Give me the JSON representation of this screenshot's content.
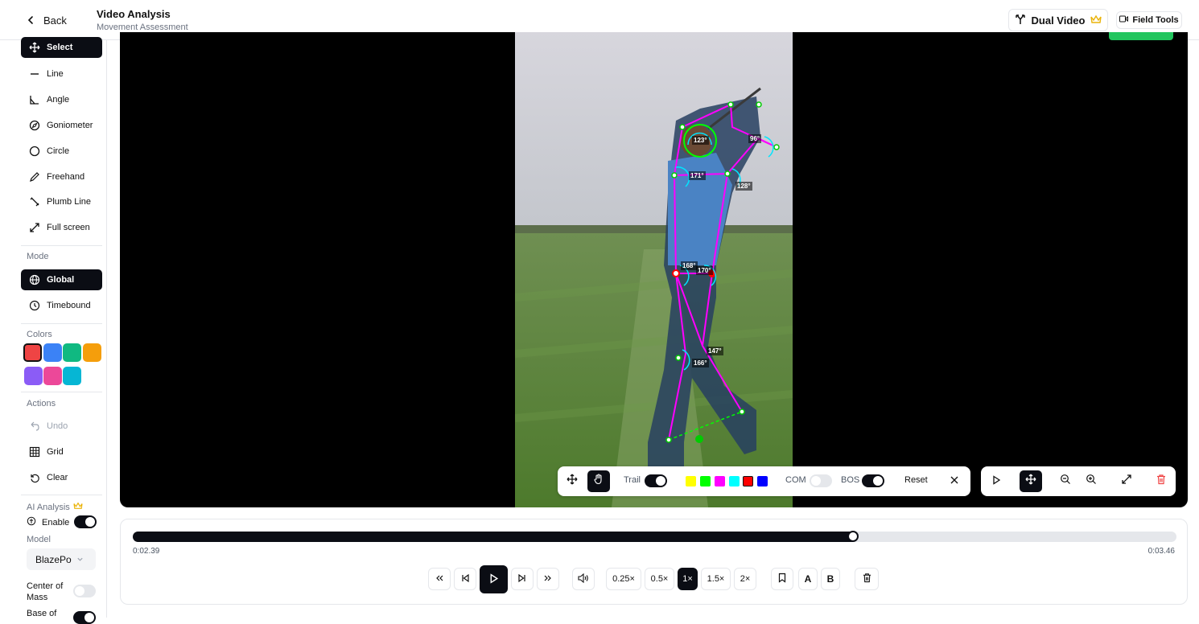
{
  "header": {
    "back_label": "Back",
    "title": "Video Analysis",
    "subtitle": "Movement Assessment",
    "dual_video_label": "Dual Video",
    "field_tools_label": "Field Tools"
  },
  "sidebar": {
    "tools": [
      {
        "label": "Select",
        "icon": "move-icon",
        "active": true
      },
      {
        "label": "Line",
        "icon": "line-icon"
      },
      {
        "label": "Angle",
        "icon": "angle-icon"
      },
      {
        "label": "Goniometer",
        "icon": "compass-icon"
      },
      {
        "label": "Circle",
        "icon": "circle-icon"
      },
      {
        "label": "Freehand",
        "icon": "pencil-icon"
      },
      {
        "label": "Plumb Line",
        "icon": "plumb-icon"
      },
      {
        "label": "Full screen",
        "icon": "expand-icon"
      }
    ],
    "mode_label": "Mode",
    "modes": [
      {
        "label": "Global",
        "icon": "globe-icon",
        "active": true
      },
      {
        "label": "Timebound",
        "icon": "clock-icon"
      }
    ],
    "colors_label": "Colors",
    "colors": [
      "#ef4444",
      "#3b82f6",
      "#10b981",
      "#f59e0b",
      "#8b5cf6",
      "#ec4899",
      "#06b6d4"
    ],
    "actions_label": "Actions",
    "actions": [
      {
        "label": "Undo",
        "icon": "undo-icon",
        "disabled": true
      },
      {
        "label": "Grid",
        "icon": "grid-icon"
      },
      {
        "label": "Clear",
        "icon": "reset-icon"
      }
    ],
    "ai_label": "AI Analysis",
    "enable_label": "Enable",
    "model_label": "Model",
    "model_value": "BlazePo",
    "com_label": "Center of Mass",
    "bos_label": "Base of"
  },
  "overlay": {
    "angles": [
      "123°",
      "96°",
      "171°",
      "128°",
      "168°",
      "170°",
      "147°",
      "166°"
    ]
  },
  "video_toolbar": {
    "trail_label": "Trail",
    "trail_colors": [
      "#ffff00",
      "#00ff00",
      "#ff00ff",
      "#00ffff",
      "#ff0000",
      "#0000ff"
    ],
    "com_label": "COM",
    "bos_label": "BOS",
    "reset_label": "Reset"
  },
  "timeline": {
    "current_time": "0:02.39",
    "total_time": "0:03.46",
    "progress": 0.69,
    "speeds": [
      "0.25×",
      "0.5×",
      "1×",
      "1.5×",
      "2×"
    ],
    "active_speed": "1×",
    "marker_a": "A",
    "marker_b": "B"
  }
}
